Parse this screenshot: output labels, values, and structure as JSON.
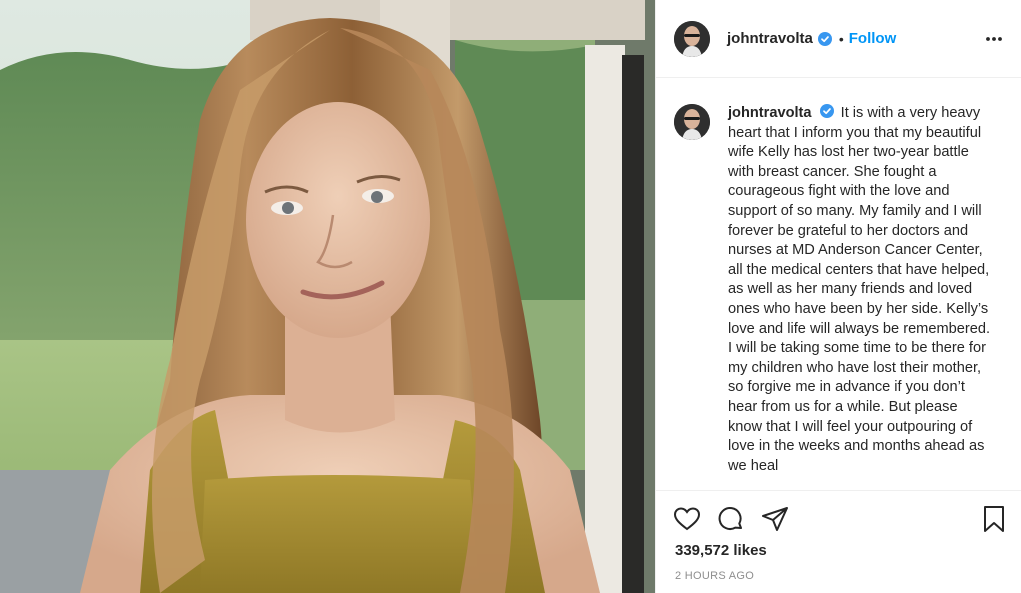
{
  "post": {
    "username": "johntravolta",
    "follow_label": "Follow",
    "separator": "•",
    "caption_user": "johntravolta",
    "caption_text": "It is with a very heavy heart that I inform you that my beautiful wife Kelly has lost her two-year battle with breast cancer. She fought a courageous fight with the love and support of so many.  My family and I will forever be grateful to her doctors and nurses at MD Anderson Cancer Center, all the medical centers that have helped, as well as her many friends and loved ones who have been by her side. Kelly’s love and life will always be remembered. I will be taking some time to be there for my children who have lost their mother, so forgive me in advance if you don’t hear from us for a while.  But please know that I will feel your outpouring of love in the weeks and months ahead as we heal",
    "likes": "339,572 likes",
    "timestamp": "2 HOURS AGO"
  },
  "icons": {
    "verified": "verified-badge-icon",
    "more": "more-options-icon",
    "like": "heart-icon",
    "comment": "comment-icon",
    "share": "share-icon",
    "save": "bookmark-icon"
  },
  "colors": {
    "accent": "#0095f6",
    "text": "#262626",
    "muted": "#8e8e8e",
    "border": "#efefef"
  }
}
